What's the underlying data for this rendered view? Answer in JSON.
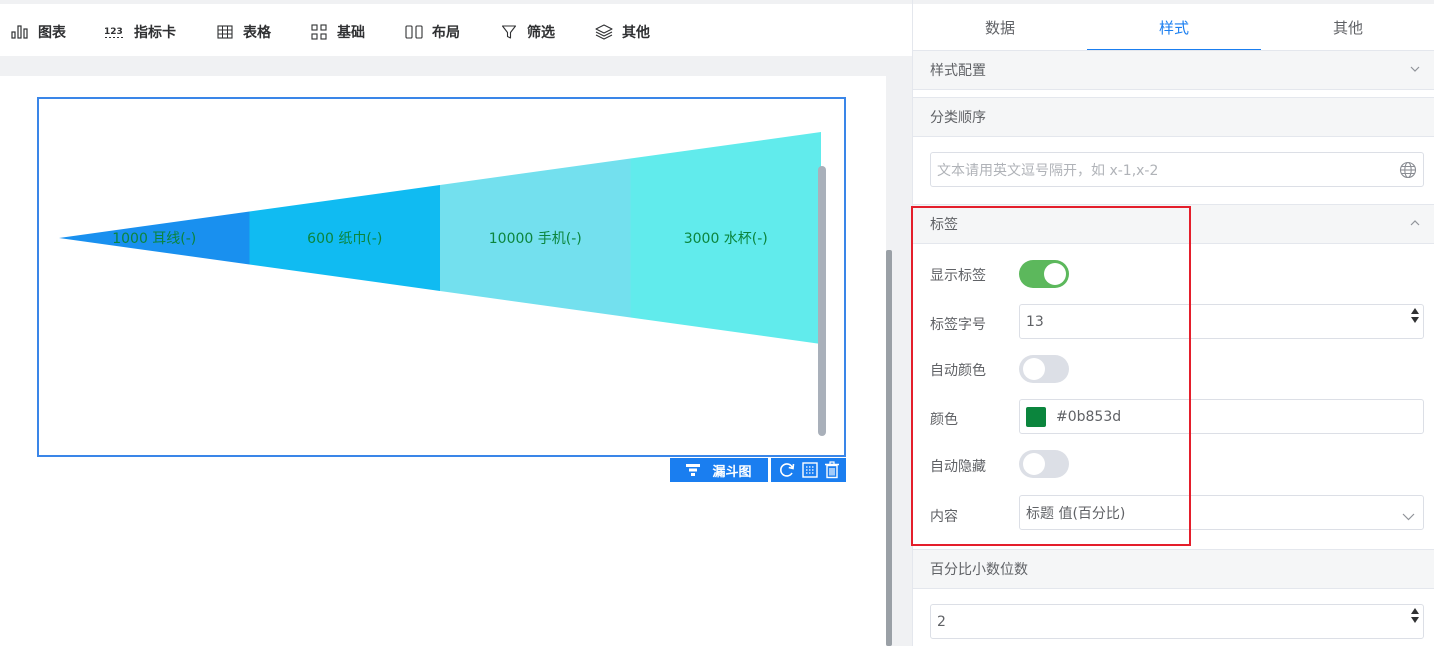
{
  "toolbar": {
    "items": [
      {
        "label": "图表",
        "icon": "bar-chart-icon"
      },
      {
        "label": "指标卡",
        "icon": "number-icon"
      },
      {
        "label": "表格",
        "icon": "table-icon"
      },
      {
        "label": "基础",
        "icon": "grid-icon"
      },
      {
        "label": "布局",
        "icon": "layout-icon"
      },
      {
        "label": "筛选",
        "icon": "filter-icon"
      },
      {
        "label": "其他",
        "icon": "layers-icon"
      }
    ]
  },
  "chart": {
    "type_button_label": "漏斗图",
    "type_button_icon": "funnel-icon"
  },
  "chart_data": {
    "type": "funnel",
    "orientation": "horizontal",
    "categories": [
      "耳线(-)",
      "纸巾(-)",
      "手机(-)",
      "水杯(-)"
    ],
    "values": [
      1000,
      600,
      10000,
      3000
    ],
    "labels": [
      "1000 耳线(-)",
      "600 纸巾(-)",
      "10000 手机(-)",
      "3000 水杯(-)"
    ],
    "colors": [
      "#1990ef",
      "#10bbf2",
      "#73e0ee",
      "#61ebec"
    ],
    "label_color": "#0b853d"
  },
  "panel": {
    "tabs": [
      "数据",
      "样式",
      "其他"
    ],
    "active_tab": "样式",
    "style_config": "样式配置",
    "category_order": {
      "title": "分类顺序",
      "placeholder": "文本请用英文逗号隔开，如 x-1,x-2"
    },
    "label_section": {
      "title": "标签",
      "show_label": {
        "label": "显示标签",
        "on": true
      },
      "font_size": {
        "label": "标签字号",
        "value": "13"
      },
      "auto_color": {
        "label": "自动颜色",
        "on": false
      },
      "color": {
        "label": "颜色",
        "value": "#0b853d"
      },
      "auto_hide": {
        "label": "自动隐藏",
        "on": false
      },
      "content": {
        "label": "内容",
        "value": "标题 值(百分比)"
      }
    },
    "percent_decimals": {
      "title": "百分比小数位数",
      "value": "2"
    }
  }
}
